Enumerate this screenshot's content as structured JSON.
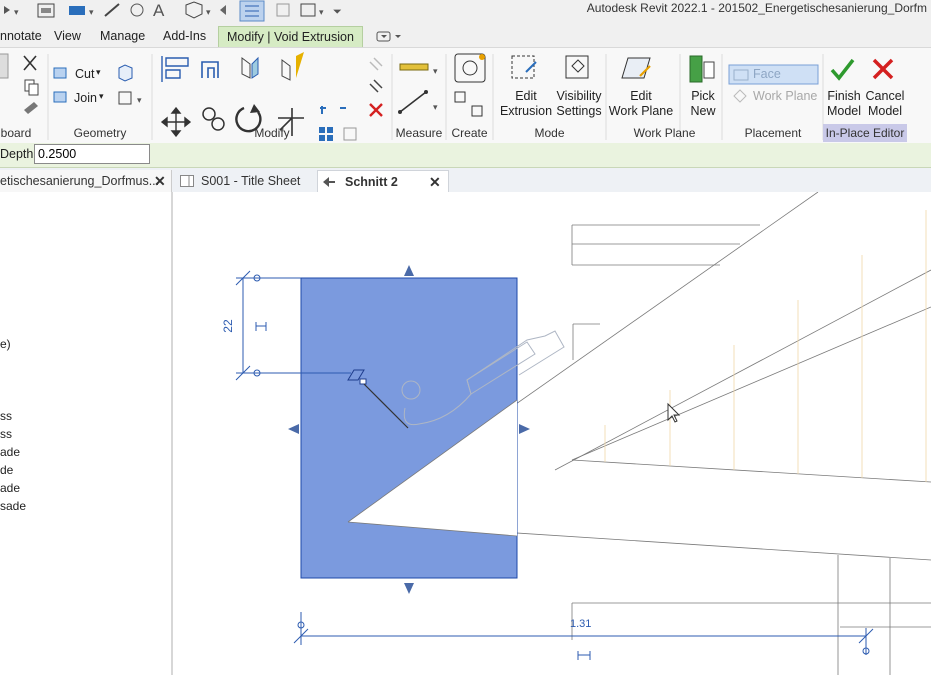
{
  "window": {
    "title": "Autodesk Revit 2022.1 - 201502_Energetischesanierung_Dorfm"
  },
  "ribbon_tabs": [
    "nnotate",
    "View",
    "Manage",
    "Add-Ins",
    "Modify | Void Extrusion"
  ],
  "ribbon": {
    "geometry": {
      "cut_label": "Cut",
      "join_label": "Join"
    },
    "edit_extrusion": {
      "line1": "Edit",
      "line2": "Extrusion"
    },
    "visibility_settings": {
      "line1": "Visibility",
      "line2": "Settings"
    },
    "edit_work_plane": {
      "line1": "Edit",
      "line2": "Work Plane"
    },
    "pick_new": {
      "line1": "Pick",
      "line2": "New"
    },
    "face_label": "Face",
    "work_plane_label": "Work Plane",
    "finish_model": {
      "line1": "Finish",
      "line2": "Model"
    },
    "cancel_model": {
      "line1": "Cancel",
      "line2": "Model"
    },
    "panels": {
      "clipboard": "board",
      "geometry": "Geometry",
      "modify": "Modify",
      "measure": "Measure",
      "create": "Create",
      "mode": "Mode",
      "work_plane": "Work Plane",
      "placement": "Placement",
      "in_place_editor": "In-Place Editor"
    }
  },
  "options_bar": {
    "depth_label": "Depth",
    "depth_value": "0.2500"
  },
  "view_tabs": {
    "project": "etischesanierung_Dorfmus...",
    "title_sheet": "S001 - Title Sheet",
    "section": "Schnitt 2"
  },
  "project_browser": {
    "items": [
      "e)",
      "ss",
      "ss",
      "ade",
      "de",
      "ade",
      "sade"
    ]
  },
  "canvas": {
    "dim_vertical": "22",
    "dim_horizontal": "1.31"
  },
  "colors": {
    "void_fill": "#7b9ade",
    "accent_tab": "#d6ebc4",
    "dimension": "#2c5bb0"
  }
}
